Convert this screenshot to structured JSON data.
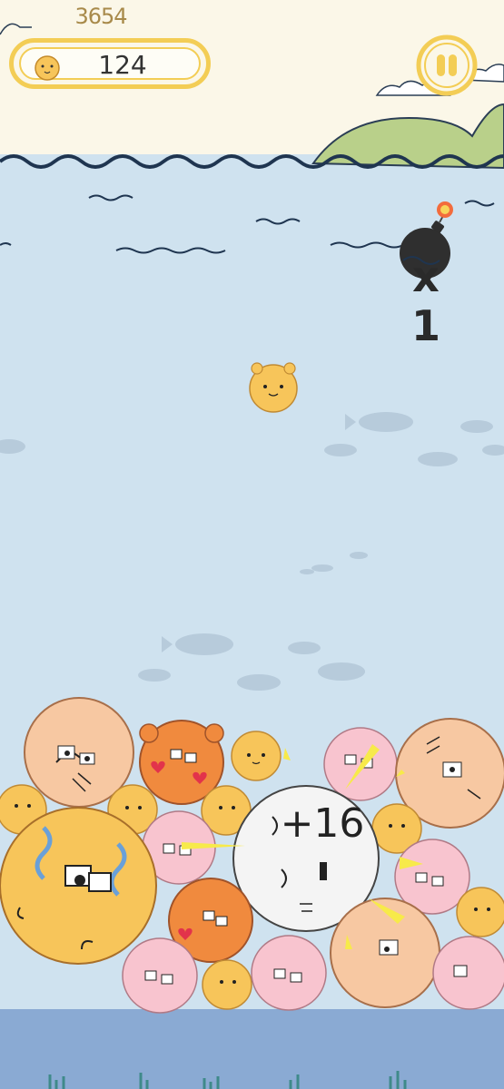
{
  "hud": {
    "best_score": "3654",
    "coins": "124"
  },
  "bomb": {
    "count_label": "x 1",
    "icon": "bomb-icon"
  },
  "merge_popup": "+16",
  "colors": {
    "sky": "#fbf7e8",
    "sea": "#cfe2ef",
    "wave": "#1f3550",
    "hud_border": "#f3cd55",
    "ball_yellow": "#f7c55a",
    "ball_orange": "#f08a3e",
    "ball_pink": "#f8c4cf",
    "ball_peach": "#f7c8a2",
    "ball_white": "#f4f4f4",
    "floor": "#8aaad3"
  }
}
